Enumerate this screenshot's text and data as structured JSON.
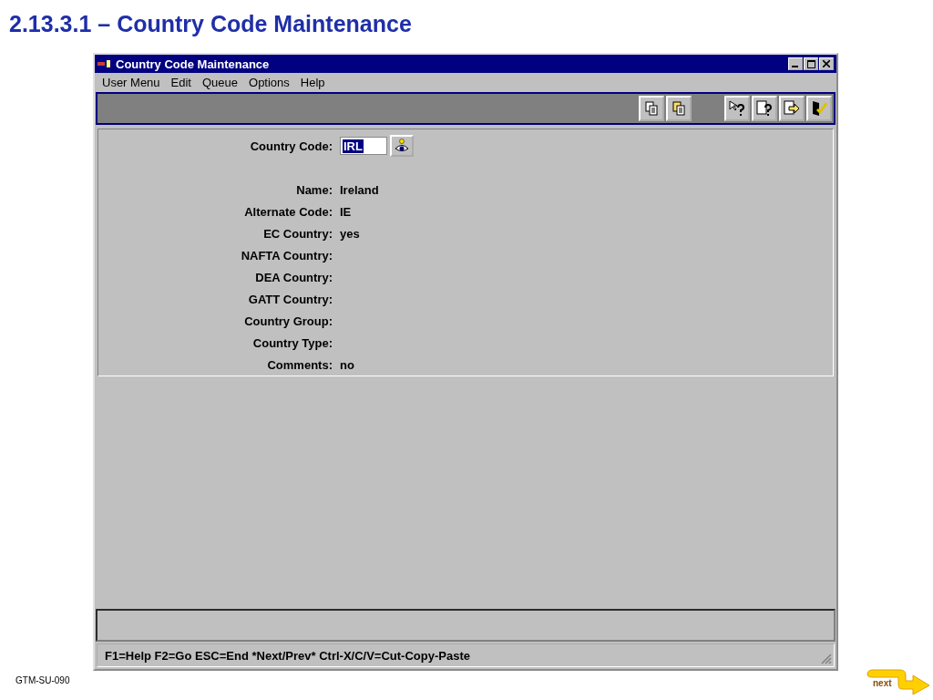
{
  "slide_title": "2.13.3.1 – Country Code Maintenance",
  "window": {
    "title": "Country Code Maintenance"
  },
  "menu": [
    "User Menu",
    "Edit",
    "Queue",
    "Options",
    "Help"
  ],
  "country_code": {
    "label": "Country Code:",
    "value": "IRL"
  },
  "fields": [
    {
      "label": "Name:",
      "value": "Ireland"
    },
    {
      "label": "Alternate Code:",
      "value": "IE"
    },
    {
      "label": "EC Country:",
      "value": "yes"
    },
    {
      "label": "NAFTA Country:"
    },
    {
      "label": "DEA Country:"
    },
    {
      "label": "GATT Country:"
    },
    {
      "label": "Country Group:"
    },
    {
      "label": "Country Type:"
    },
    {
      "label": "Comments:",
      "value": "no"
    }
  ],
  "status_bar": "F1=Help F2=Go ESC=End  *Next/Prev*  Ctrl-X/C/V=Cut-Copy-Paste",
  "footer": "GTM-SU-090",
  "next_link": "next"
}
